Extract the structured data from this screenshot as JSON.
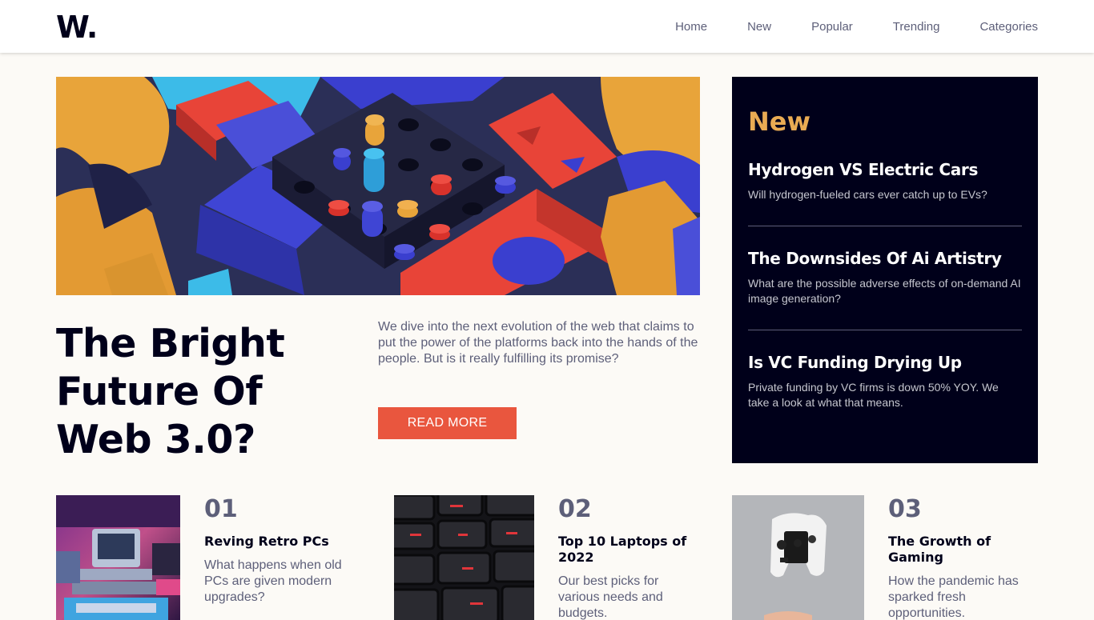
{
  "logo": "W.",
  "nav": [
    "Home",
    "New",
    "Popular",
    "Trending",
    "Categories"
  ],
  "hero": {
    "title": "The Bright Future Of Web 3.0?",
    "description": "We dive into the next evolution of the web that claims to put the power of the platforms back into the hands of the people. But is it really fulfilling its promise?",
    "button": "READ MORE"
  },
  "new_panel": {
    "heading": "New",
    "items": [
      {
        "title": "Hydrogen VS Electric Cars",
        "desc": "Will hydrogen-fueled cars ever catch up to EVs?"
      },
      {
        "title": "The Downsides Of Ai Artistry",
        "desc": "What are the possible adverse effects of on-demand AI image generation?"
      },
      {
        "title": "Is VC Funding Drying Up",
        "desc": "Private funding by VC firms is down 50% YOY. We take a look at what that means."
      }
    ]
  },
  "cards": [
    {
      "num": "01",
      "title": "Reving Retro PCs",
      "desc": "What happens when old PCs are given modern upgrades?"
    },
    {
      "num": "02",
      "title": "Top 10 Laptops of 2022",
      "desc": "Our best picks for various needs and budgets."
    },
    {
      "num": "03",
      "title": "The Growth of Gaming",
      "desc": "How the pandemic has sparked fresh opportunities."
    }
  ],
  "colors": {
    "accent": "#e9563e",
    "gold": "#e9ab53",
    "dark": "#00001a",
    "muted": "#5d5f79"
  }
}
